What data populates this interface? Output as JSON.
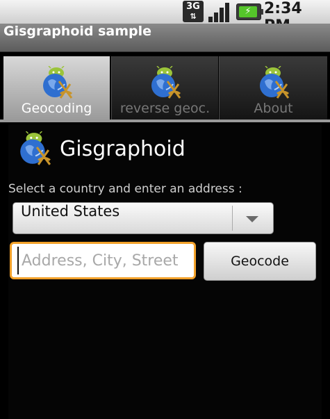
{
  "status_bar": {
    "network_type": "3G",
    "time": "2:34 PM",
    "icons": [
      "3g-data-icon",
      "signal-strength-icon",
      "battery-charging-icon"
    ]
  },
  "titlebar": {
    "title": "Gisgraphoid sample"
  },
  "tabs": [
    {
      "label": "Geocoding",
      "icon": "globe-android-icon",
      "selected": true
    },
    {
      "label": "reverse geoc.",
      "icon": "globe-android-icon",
      "selected": false
    },
    {
      "label": "About",
      "icon": "globe-android-icon",
      "selected": false
    }
  ],
  "content": {
    "app_name": "Gisgraphoid",
    "app_icon": "globe-android-icon",
    "prompt": "Select a country and enter an address :",
    "country_select": {
      "selected": "United States"
    },
    "address_input": {
      "value": "",
      "placeholder": "Address, City, Street"
    },
    "geocode_button_label": "Geocode"
  },
  "colors": {
    "focus_border": "#f2a12a",
    "title_bar": "#6e6e6e",
    "battery_green": "#55c52a"
  }
}
